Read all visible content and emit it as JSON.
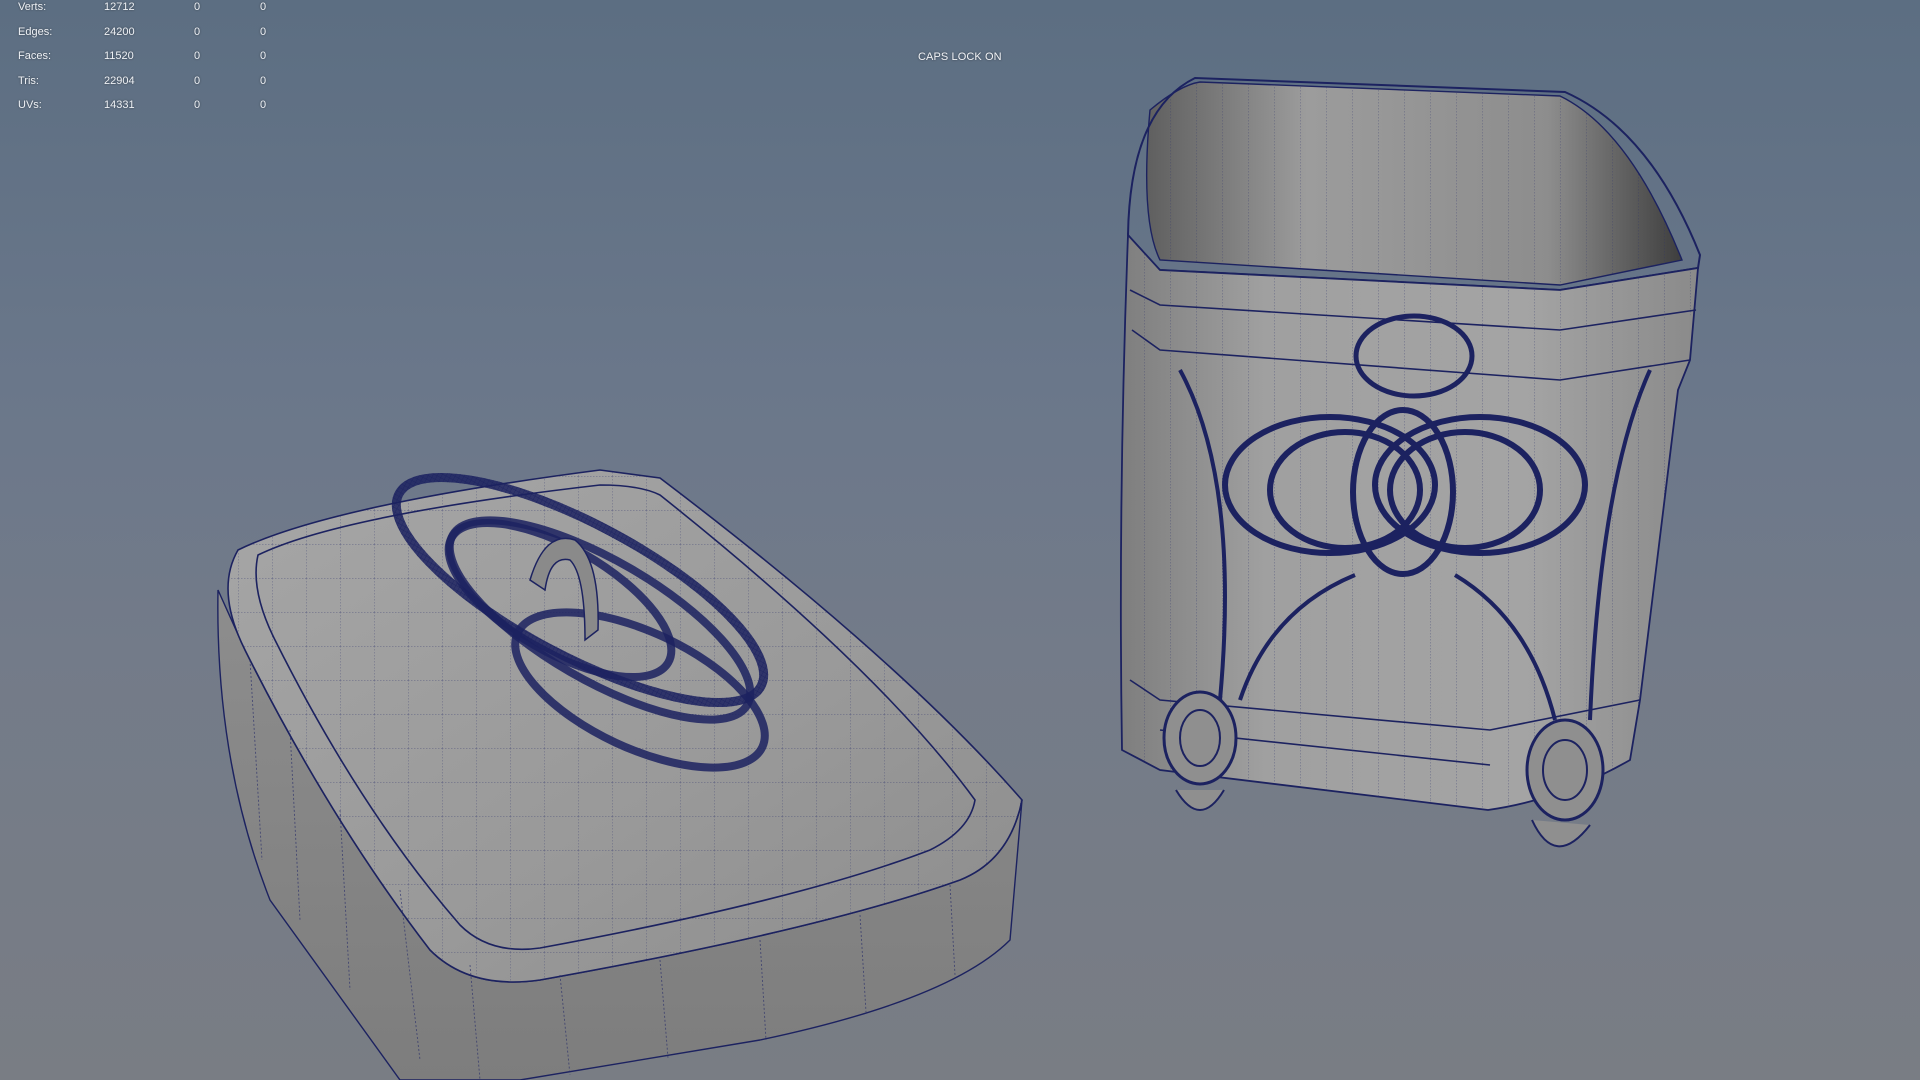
{
  "hud": {
    "rows": [
      {
        "label": "Verts:",
        "total": "12712",
        "selected": "0",
        "components": "0"
      },
      {
        "label": "Edges:",
        "total": "24200",
        "selected": "0",
        "components": "0"
      },
      {
        "label": "Faces:",
        "total": "11520",
        "selected": "0",
        "components": "0"
      },
      {
        "label": "Tris:",
        "total": "22904",
        "selected": "0",
        "components": "0"
      },
      {
        "label": "UVs:",
        "total": "14331",
        "selected": "0",
        "components": "0"
      }
    ]
  },
  "viewport": {
    "caps_lock_message": "CAPS LOCK ON"
  },
  "colors": {
    "background_top": "#5c6e82",
    "background_bottom": "#797d84",
    "mesh_surface": "#9a9a9a",
    "wireframe": "#1c2260"
  }
}
